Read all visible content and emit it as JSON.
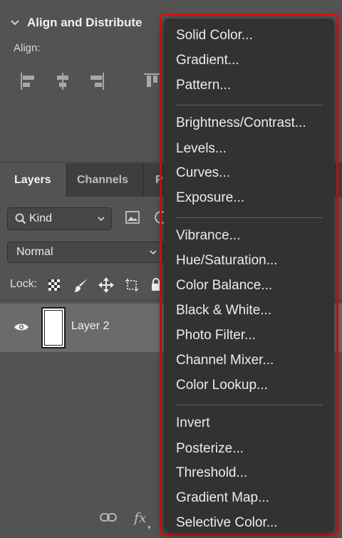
{
  "align_panel": {
    "title": "Align and Distribute",
    "align_label": "Align:"
  },
  "layers_panel": {
    "tabs": [
      "Layers",
      "Channels",
      "P"
    ],
    "kind_filter": "Kind",
    "blend_mode": "Normal",
    "lock_label": "Lock:",
    "layers": [
      {
        "name": "Layer 2",
        "visible": true
      }
    ],
    "fx_label": "fx"
  },
  "adjustment_menu": {
    "items": [
      "Solid Color...",
      "Gradient...",
      "Pattern...",
      "Brightness/Contrast...",
      "Levels...",
      "Curves...",
      "Exposure...",
      "Vibrance...",
      "Hue/Saturation...",
      "Color Balance...",
      "Black & White...",
      "Photo Filter...",
      "Channel Mixer...",
      "Color Lookup...",
      "Invert",
      "Posterize...",
      "Threshold...",
      "Gradient Map...",
      "Selective Color..."
    ],
    "highlight_color": "#e01010"
  }
}
